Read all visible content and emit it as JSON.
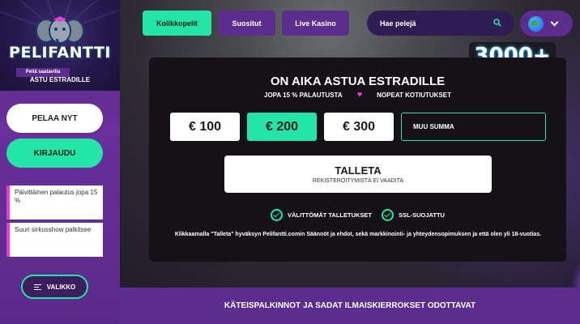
{
  "brand": {
    "logo_text": "PELIFANTTI",
    "tagline": "ASTU ESTRADILLE"
  },
  "sidebar": {
    "play_label": "PELAA NYT",
    "login_label": "KIRJAUDU",
    "promos": [
      {
        "text": "Päivittäinen palautus jopa 15 %"
      },
      {
        "text": "Suuri sirkusshow palkitsee"
      }
    ],
    "menu_label": "VALIKKO"
  },
  "nav": {
    "tabs": [
      {
        "label": "Kolikkopelit",
        "active": true
      },
      {
        "label": "Suositut",
        "active": false
      },
      {
        "label": "Live Kasino",
        "active": false
      }
    ],
    "search_placeholder": "Hae pelejä"
  },
  "badge": {
    "count": "3000+",
    "caption": "Peliä saatavilla"
  },
  "deposit": {
    "title": "ON AIKA ASTUA ESTRADILLE",
    "perk_1": "JOPA 15 % PALAUTUSTA",
    "perk_2": "NOPEAT KOTIUTUKSET",
    "amounts": [
      "€ 100",
      "€ 200",
      "€ 300"
    ],
    "selected_amount": "€ 200",
    "custom_placeholder": "MUU SUMMA",
    "button_label": "TALLETA",
    "button_sub": "REKISTERÖITYMISTÄ EI VAADITA",
    "feature_1": "VÄLITTÖMÄT TALLETUKSET",
    "feature_2": "SSL-SUOJATTU",
    "terms": "Klikkaamalla \"Talleta\" hyväksyn Pelifantti.comin Säännöt ja ehdot, sekä markkinointi- ja yhteydensopimuksen ja että olen yli 18-vuotias."
  },
  "bottom_banner": "KÄTEISPALKINNOT JA SADAT ILMAISKIERROKSET ODOTTAVAT",
  "colors": {
    "accent_green": "#23e6a6",
    "purple": "#5b2d8e",
    "pink": "#e63bd6"
  }
}
